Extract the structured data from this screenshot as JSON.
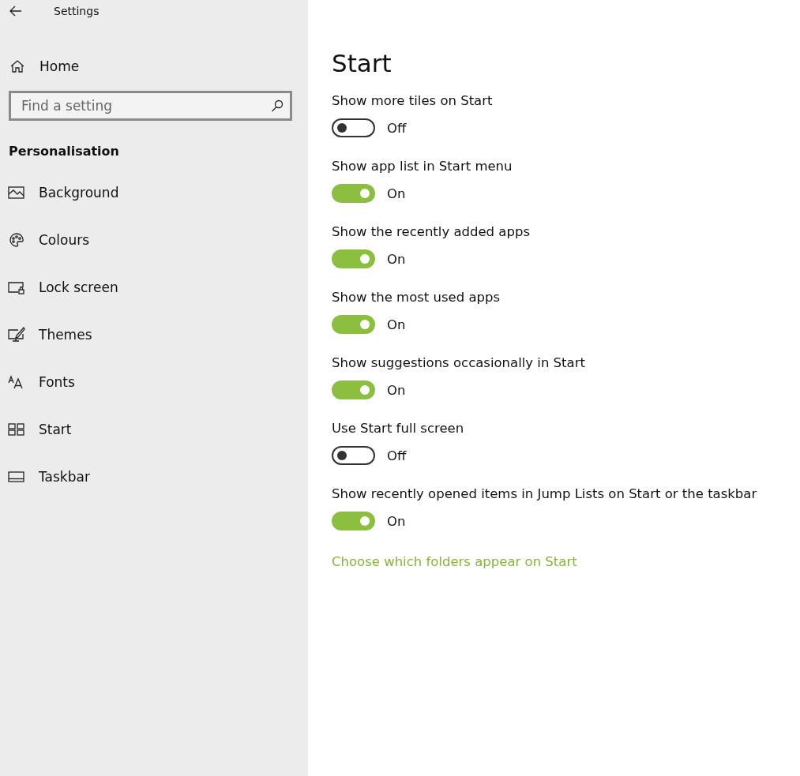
{
  "window": {
    "title": "Settings"
  },
  "sidebar": {
    "home": "Home",
    "search": {
      "placeholder": "Find a setting"
    },
    "section": "Personalisation",
    "items": [
      {
        "label": "Background"
      },
      {
        "label": "Colours"
      },
      {
        "label": "Lock screen"
      },
      {
        "label": "Themes"
      },
      {
        "label": "Fonts"
      },
      {
        "label": "Start"
      },
      {
        "label": "Taskbar"
      }
    ]
  },
  "page": {
    "title": "Start",
    "settings": [
      {
        "label": "Show more tiles on Start",
        "on": false,
        "state": "Off"
      },
      {
        "label": "Show app list in Start menu",
        "on": true,
        "state": "On"
      },
      {
        "label": "Show the recently added apps",
        "on": true,
        "state": "On"
      },
      {
        "label": "Show the most used apps",
        "on": true,
        "state": "On"
      },
      {
        "label": "Show suggestions occasionally in Start",
        "on": true,
        "state": "On"
      },
      {
        "label": "Use Start full screen",
        "on": false,
        "state": "Off"
      },
      {
        "label": "Show recently opened items in Jump Lists on Start or the taskbar",
        "on": true,
        "state": "On"
      }
    ],
    "link": "Choose which folders appear on Start"
  }
}
